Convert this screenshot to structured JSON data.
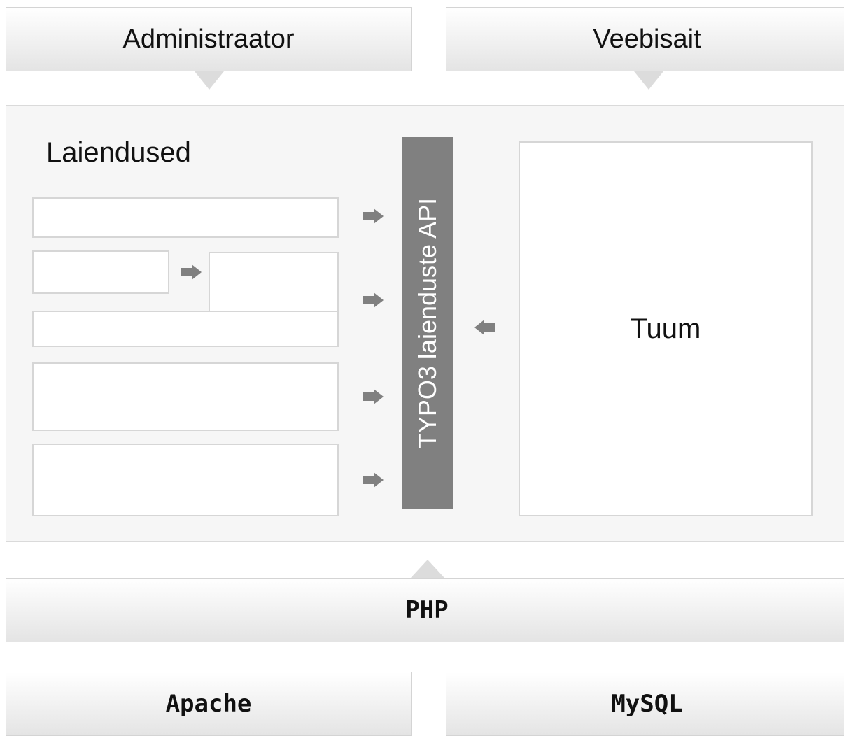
{
  "top": {
    "left_label": "Administraator",
    "right_label": "Veebisait"
  },
  "core": {
    "extensions_title": "Laiendused",
    "api_label": "TYPO3 laienduste API",
    "core_label": "Tuum"
  },
  "php_label": "PHP",
  "bottom": {
    "left_label": "Apache",
    "right_label": "MySQL"
  },
  "colors": {
    "api_bar": "#808080",
    "arrow": "#808080",
    "panel": "#f6f6f6"
  }
}
